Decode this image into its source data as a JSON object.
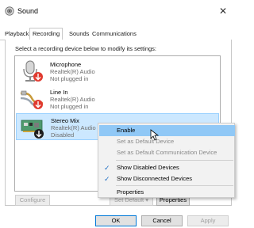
{
  "window": {
    "title": "Sound",
    "close": "✕"
  },
  "tabs": [
    "Playback",
    "Recording",
    "Sounds",
    "Communications"
  ],
  "instruction": "Select a recording device below to modify its settings:",
  "devices": [
    {
      "name": "Microphone",
      "driver": "Realtek(R) Audio",
      "status": "Not plugged in"
    },
    {
      "name": "Line In",
      "driver": "Realtek(R) Audio",
      "status": "Not plugged in"
    },
    {
      "name": "Stereo Mix",
      "driver": "Realtek(R) Audio",
      "status": "Disabled"
    }
  ],
  "buttons": {
    "configure": "Configure",
    "set_default": "Set Default",
    "set_default_arrow": "▾",
    "properties": "Properties",
    "ok": "OK",
    "cancel": "Cancel",
    "apply": "Apply"
  },
  "context_menu": {
    "items": [
      {
        "label": "Enable"
      },
      {
        "label": "Set as Default Device"
      },
      {
        "label": "Set as Default Communication Device"
      },
      {
        "label": "Show Disabled Devices",
        "checked": true
      },
      {
        "label": "Show Disconnected Devices",
        "checked": true
      },
      {
        "label": "Properties"
      }
    ],
    "check_glyph": "✓"
  }
}
